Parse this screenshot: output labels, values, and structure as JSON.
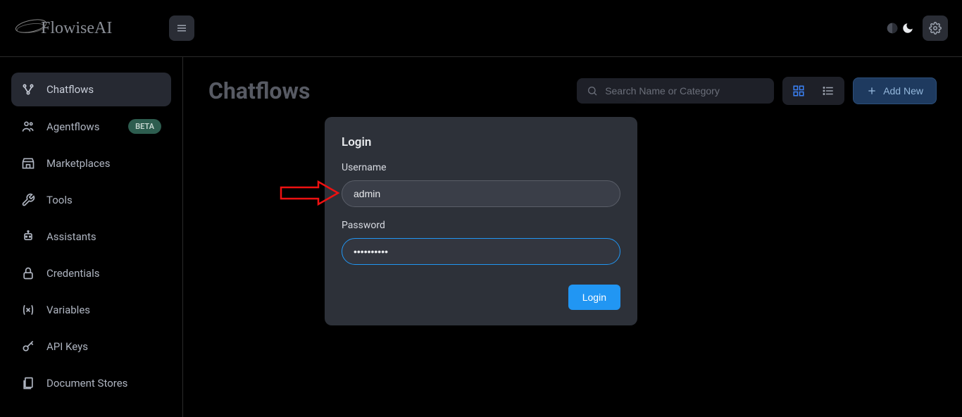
{
  "header": {
    "logo_text": "FlowiseAI"
  },
  "sidebar": {
    "items": [
      {
        "label": "Chatflows",
        "icon": "workflow"
      },
      {
        "label": "Agentflows",
        "icon": "agents",
        "badge": "BETA"
      },
      {
        "label": "Marketplaces",
        "icon": "store"
      },
      {
        "label": "Tools",
        "icon": "wrench"
      },
      {
        "label": "Assistants",
        "icon": "assistant"
      },
      {
        "label": "Credentials",
        "icon": "lock"
      },
      {
        "label": "Variables",
        "icon": "variables"
      },
      {
        "label": "API Keys",
        "icon": "key"
      },
      {
        "label": "Document Stores",
        "icon": "documents"
      }
    ]
  },
  "page": {
    "title": "Chatflows",
    "search_placeholder": "Search Name or Category",
    "add_button": "Add New"
  },
  "modal": {
    "title": "Login",
    "username_label": "Username",
    "username_value": "admin",
    "password_label": "Password",
    "password_value": "••••••••••",
    "login_button": "Login"
  }
}
